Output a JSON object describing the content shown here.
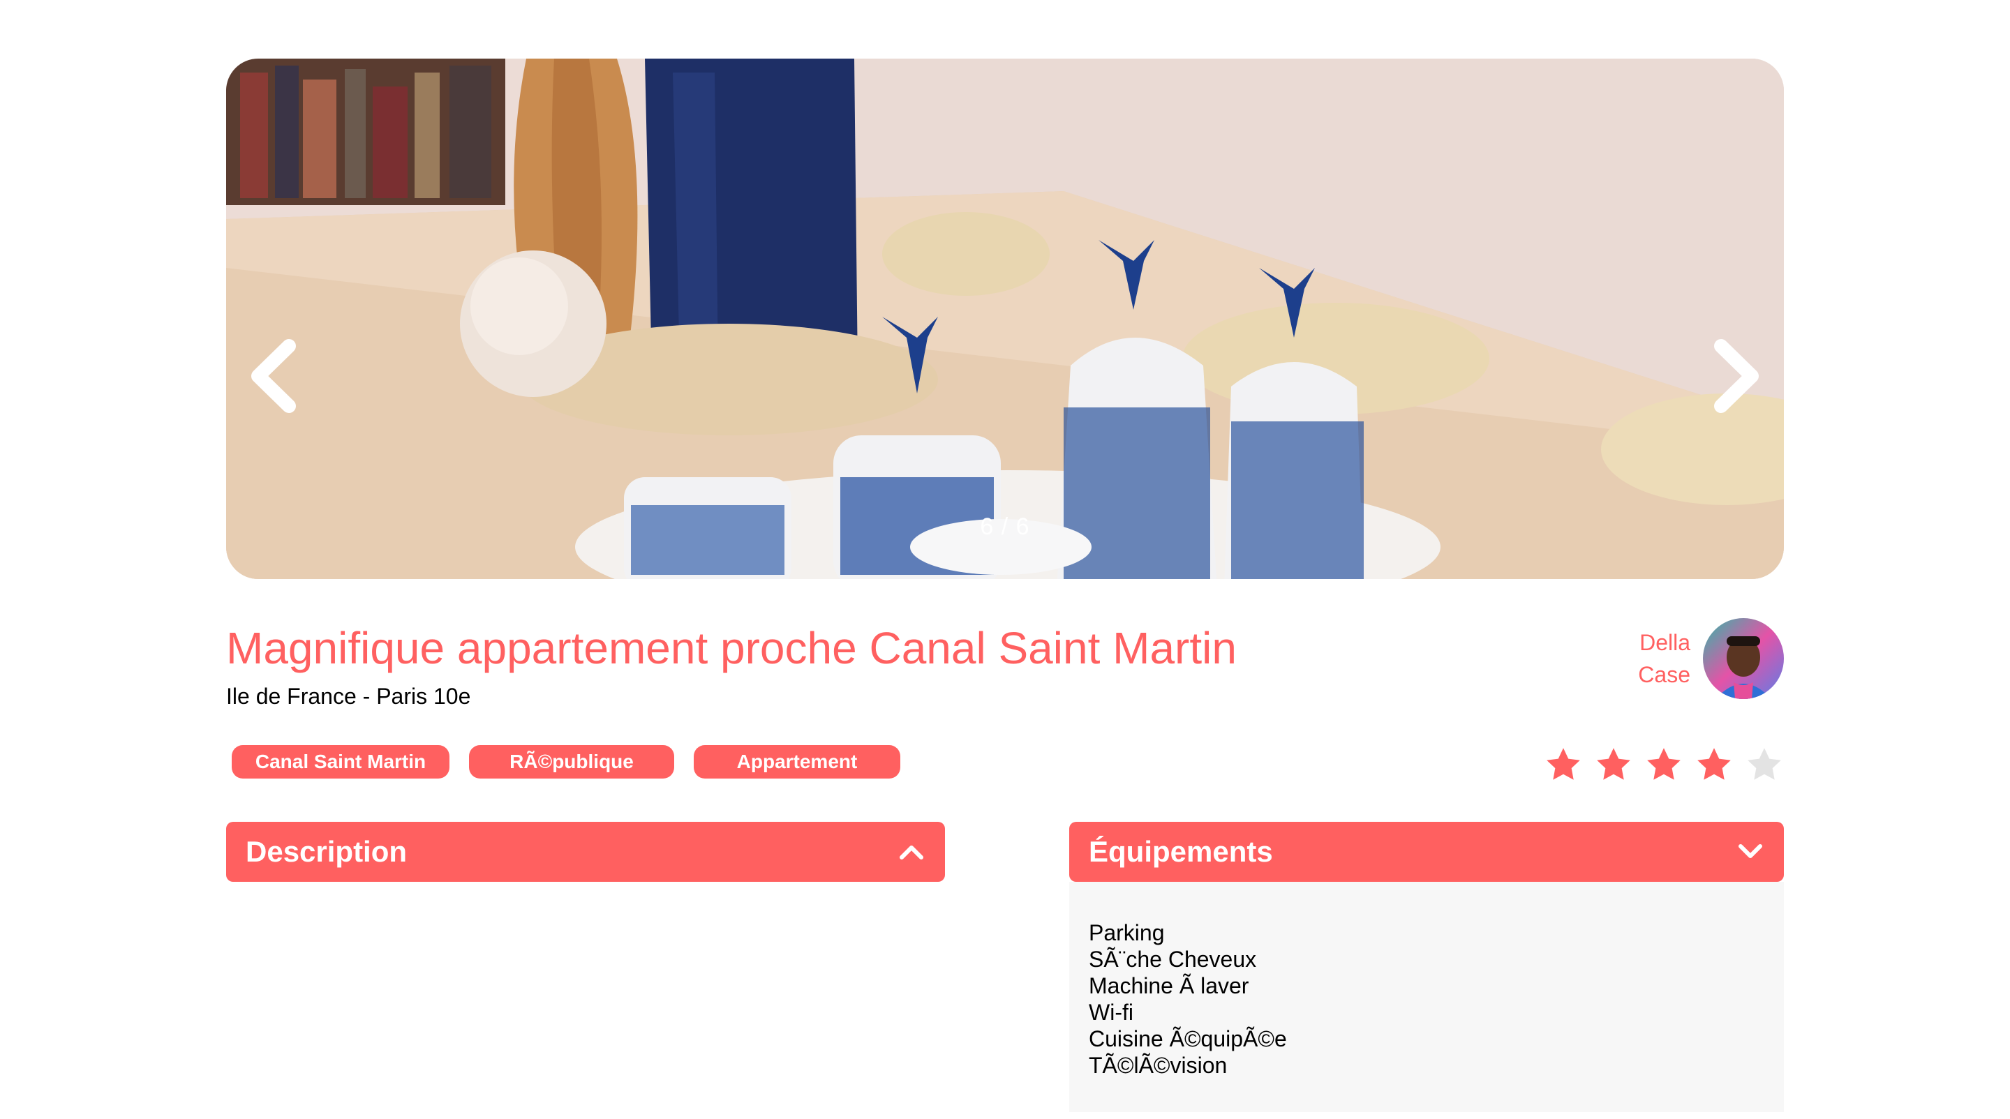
{
  "carousel": {
    "counter": "6 / 6",
    "prev_icon": "chevron-left-icon",
    "next_icon": "chevron-right-icon"
  },
  "listing": {
    "title": "Magnifique appartement proche Canal Saint Martin",
    "location": "Ile de France - Paris 10e",
    "tags": [
      "Canal Saint Martin",
      "RÃ©publique",
      "Appartement"
    ],
    "rating": 4,
    "rating_max": 5
  },
  "host": {
    "first_name": "Della",
    "last_name": "Case"
  },
  "description": {
    "title": "Description",
    "expanded": true,
    "icon": "chevron-up-icon"
  },
  "equipments": {
    "title": "Équipements",
    "expanded": true,
    "icon": "chevron-down-icon",
    "items": [
      "Parking",
      "SÃ¨che Cheveux",
      "Machine Ã  laver",
      "Wi-fi",
      "Cuisine Ã©quipÃ©e",
      "TÃ©lÃ©vision"
    ]
  },
  "colors": {
    "accent": "#FF6060",
    "star_empty": "#E3E3E3",
    "panel_bg": "#F7F7F7"
  }
}
